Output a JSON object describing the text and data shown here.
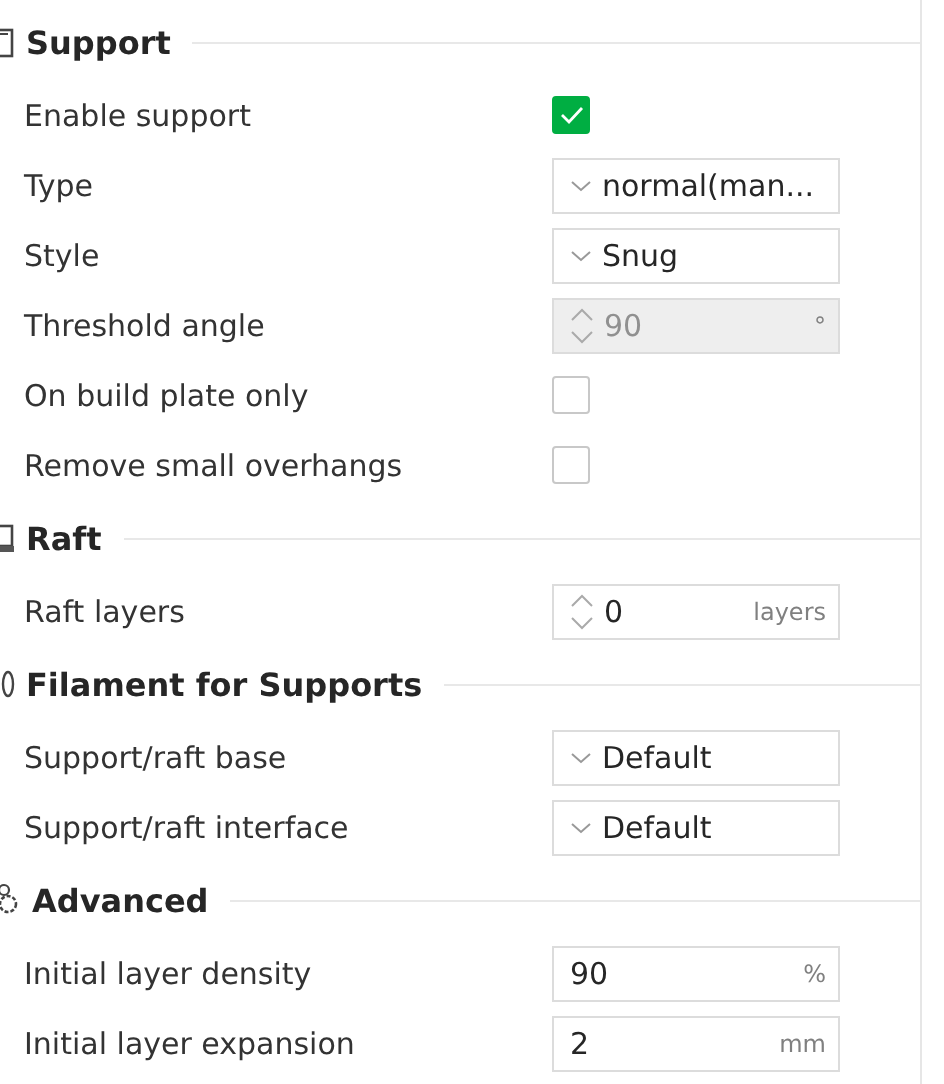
{
  "sections": [
    {
      "title": "Support",
      "rows": [
        {
          "kind": "checkbox",
          "label": "Enable support",
          "checked": true
        },
        {
          "kind": "dropdown",
          "label": "Type",
          "value": "normal(man..."
        },
        {
          "kind": "dropdown",
          "label": "Style",
          "value": "Snug"
        },
        {
          "kind": "spin",
          "label": "Threshold angle",
          "value": "90",
          "unit": "°",
          "disabled": true
        },
        {
          "kind": "checkbox",
          "label": "On build plate only",
          "checked": false
        },
        {
          "kind": "checkbox",
          "label": "Remove small overhangs",
          "checked": false
        }
      ]
    },
    {
      "title": "Raft",
      "rows": [
        {
          "kind": "spin",
          "label": "Raft layers",
          "value": "0",
          "unit": "layers",
          "disabled": false
        }
      ]
    },
    {
      "title": "Filament for Supports",
      "rows": [
        {
          "kind": "dropdown",
          "label": "Support/raft base",
          "value": "Default"
        },
        {
          "kind": "dropdown",
          "label": "Support/raft interface",
          "value": "Default"
        }
      ]
    },
    {
      "title": "Advanced",
      "rows": [
        {
          "kind": "number",
          "label": "Initial layer density",
          "value": "90",
          "unit": "%"
        },
        {
          "kind": "number",
          "label": "Initial layer expansion",
          "value": "2",
          "unit": "mm"
        }
      ]
    }
  ]
}
